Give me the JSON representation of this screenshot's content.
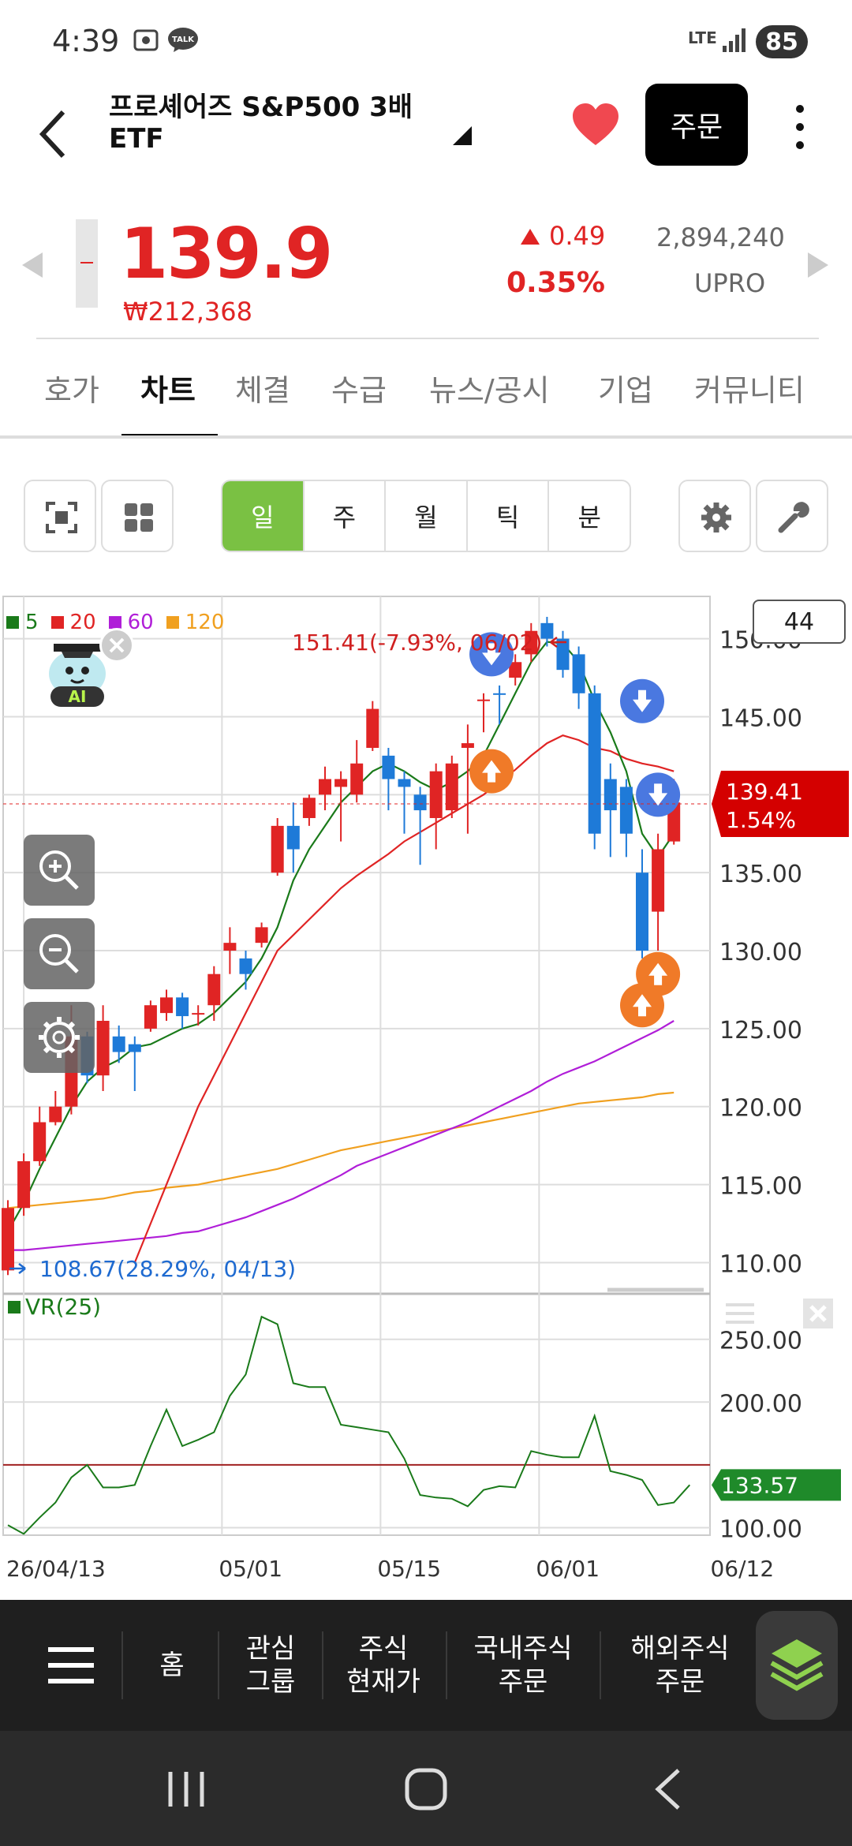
{
  "status_bar": {
    "time": "4:39",
    "talk_badge": "TALK",
    "network": "LTE",
    "battery": "85"
  },
  "header": {
    "title": "프로셰어즈 S&P500 3배 ETF",
    "order_button": "주문"
  },
  "quote": {
    "price": "139.9",
    "krw_price": "₩212,368",
    "change": "0.49",
    "change_pct": "0.35%",
    "volume": "2,894,240",
    "ticker": "UPRO"
  },
  "tabs": [
    "호가",
    "차트",
    "체결",
    "수급",
    "뉴스/공시",
    "기업",
    "커뮤니티"
  ],
  "active_tab": "차트",
  "period_buttons": [
    "일",
    "주",
    "월",
    "틱",
    "분"
  ],
  "active_period": "일",
  "chart_data": {
    "type": "candlestick",
    "legend": [
      {
        "name": "5",
        "color": "#1a7a1a"
      },
      {
        "name": "20",
        "color": "#e02424"
      },
      {
        "name": "60",
        "color": "#b01ed8"
      },
      {
        "name": "120",
        "color": "#f0a020"
      }
    ],
    "count_box": "44",
    "y_ticks": [
      "150.00",
      "145.00",
      "140.00",
      "135.00",
      "130.00",
      "125.00",
      "120.00",
      "115.00",
      "110.00"
    ],
    "y_tick_values": [
      150,
      145,
      140,
      135,
      130,
      125,
      120,
      115,
      110
    ],
    "ylim": [
      108.0,
      151.7
    ],
    "x_labels": [
      "26/04/13",
      "05/01",
      "05/15",
      "06/01",
      "06/12"
    ],
    "x_label_index": [
      1,
      13.5,
      23.5,
      33.5,
      44.5
    ],
    "high_annotation": "151.41(-7.93%, 06/02)",
    "low_annotation": "108.67(28.29%, 04/13)",
    "current_price_label": "139.41",
    "current_pct_label": "1.54%",
    "current_price": 139.41,
    "candles": [
      [
        109.5,
        113.5,
        109.2,
        114.0
      ],
      [
        113.5,
        116.5,
        113.0,
        117.0
      ],
      [
        116.5,
        119.0,
        116.2,
        120.0
      ],
      [
        119.0,
        120.0,
        118.8,
        121.0
      ],
      [
        120.0,
        124.5,
        119.5,
        126.5
      ],
      [
        124.5,
        122.0,
        121.5,
        124.8
      ],
      [
        122.0,
        125.5,
        121.0,
        126.5
      ],
      [
        124.5,
        123.5,
        122.8,
        125.2
      ],
      [
        124.0,
        123.5,
        121.0,
        124.5
      ],
      [
        125.0,
        126.5,
        124.8,
        126.8
      ],
      [
        126.0,
        127.0,
        125.5,
        127.5
      ],
      [
        127.0,
        125.8,
        125.0,
        127.3
      ],
      [
        126.0,
        126.0,
        125.2,
        126.5
      ],
      [
        126.5,
        128.5,
        125.5,
        129.0
      ],
      [
        130.0,
        130.5,
        128.5,
        131.5
      ],
      [
        129.5,
        128.5,
        127.5,
        130.0
      ],
      [
        130.5,
        131.5,
        130.2,
        131.8
      ],
      [
        135.0,
        138.0,
        134.8,
        138.5
      ],
      [
        138.0,
        136.5,
        135.0,
        139.5
      ],
      [
        138.5,
        139.8,
        138.0,
        140.0
      ],
      [
        140.0,
        141.0,
        139.0,
        141.8
      ],
      [
        140.5,
        141.0,
        137.0,
        141.5
      ],
      [
        140.0,
        142.0,
        139.5,
        143.5
      ],
      [
        143.0,
        145.5,
        142.8,
        146.0
      ],
      [
        142.5,
        141.0,
        139.0,
        143.0
      ],
      [
        141.0,
        140.5,
        137.5,
        141.5
      ],
      [
        140.0,
        139.0,
        135.5,
        140.5
      ],
      [
        138.5,
        141.5,
        136.5,
        142.0
      ],
      [
        139.0,
        142.0,
        138.5,
        142.5
      ],
      [
        143.0,
        143.3,
        137.5,
        144.5
      ],
      [
        146.0,
        146.1,
        144.0,
        146.5
      ],
      [
        146.5,
        146.4,
        144.5,
        147.0
      ],
      [
        147.5,
        148.5,
        147.0,
        149.0
      ],
      [
        149.0,
        150.5,
        148.5,
        151.0
      ],
      [
        151.0,
        150.0,
        149.5,
        151.4
      ],
      [
        150.0,
        148.0,
        147.5,
        150.5
      ],
      [
        149.0,
        146.5,
        145.5,
        149.5
      ],
      [
        146.5,
        137.5,
        136.5,
        147.0
      ],
      [
        141.0,
        139.0,
        136.0,
        142.0
      ],
      [
        140.5,
        137.5,
        136.0,
        141.0
      ],
      [
        135.0,
        130.0,
        129.5,
        136.5
      ],
      [
        132.5,
        136.5,
        130.0,
        137.5
      ],
      [
        137.0,
        139.5,
        136.8,
        141.0
      ]
    ],
    "ma5": [
      112.0,
      113.8,
      116.0,
      118.0,
      120.0,
      121.6,
      122.5,
      123.0,
      123.8,
      124.0,
      124.5,
      125.0,
      125.3,
      126.0,
      127.0,
      128.0,
      129.5,
      131.5,
      134.5,
      136.5,
      138.0,
      139.5,
      140.5,
      141.5,
      142.0,
      141.5,
      140.8,
      140.3,
      140.8,
      141.5,
      142.5,
      144.5,
      146.5,
      148.5,
      149.8,
      149.7,
      148.5,
      146.0,
      144.0,
      141.5,
      137.5,
      136.0,
      137.5
    ],
    "ma20": [
      null,
      null,
      null,
      null,
      null,
      null,
      null,
      null,
      110.0,
      112.5,
      115.0,
      117.5,
      120.0,
      122.0,
      124.0,
      126.0,
      128.0,
      130.0,
      131.0,
      132.0,
      133.0,
      134.0,
      134.8,
      135.5,
      136.2,
      137.0,
      137.6,
      138.2,
      138.8,
      139.4,
      140.0,
      140.8,
      141.6,
      142.5,
      143.3,
      143.8,
      143.5,
      143.0,
      142.8,
      142.3,
      142.0,
      141.8,
      141.5
    ],
    "ma60": [
      110.8,
      110.8,
      110.9,
      111.0,
      111.1,
      111.2,
      111.3,
      111.4,
      111.5,
      111.6,
      111.7,
      111.9,
      112.0,
      112.3,
      112.6,
      112.9,
      113.3,
      113.7,
      114.1,
      114.6,
      115.1,
      115.6,
      116.2,
      116.6,
      117.0,
      117.4,
      117.8,
      118.2,
      118.6,
      119.0,
      119.5,
      120.0,
      120.5,
      121.0,
      121.6,
      122.1,
      122.5,
      122.9,
      123.4,
      123.9,
      124.4,
      124.9,
      125.5
    ],
    "ma120": [
      113.5,
      113.6,
      113.7,
      113.8,
      113.9,
      114.0,
      114.1,
      114.3,
      114.5,
      114.6,
      114.8,
      114.9,
      115.0,
      115.2,
      115.4,
      115.6,
      115.8,
      116.0,
      116.3,
      116.6,
      116.9,
      117.2,
      117.4,
      117.6,
      117.8,
      118.0,
      118.2,
      118.4,
      118.6,
      118.8,
      119.0,
      119.2,
      119.4,
      119.6,
      119.8,
      120.0,
      120.2,
      120.3,
      120.4,
      120.5,
      120.6,
      120.8,
      120.9
    ],
    "signals": [
      {
        "index": 30.5,
        "type": "sell",
        "price": 149.0
      },
      {
        "index": 30.5,
        "type": "buy",
        "price": 141.5
      },
      {
        "index": 40.0,
        "type": "sell",
        "price": 146.0
      },
      {
        "index": 41.0,
        "type": "sell",
        "price": 140.0
      },
      {
        "index": 41.0,
        "type": "buy",
        "price": 128.5
      },
      {
        "index": 40.0,
        "type": "buy",
        "price": 126.5
      }
    ],
    "vr": {
      "label": "VR(25)",
      "y_ticks": [
        "250.00",
        "200.00",
        "100.00"
      ],
      "y_tick_values": [
        250,
        200,
        100
      ],
      "ylim": [
        94,
        280
      ],
      "reference_line": 150,
      "current_label": "133.57",
      "values": [
        102,
        95,
        108,
        120,
        140,
        150,
        132,
        132,
        134,
        165,
        194,
        165,
        170,
        176,
        205,
        222,
        268,
        262,
        215,
        212,
        212,
        182,
        180,
        178,
        176,
        155,
        126,
        124,
        123,
        117,
        130,
        133,
        132,
        161,
        158,
        156,
        156,
        189,
        145,
        142,
        138,
        118,
        120,
        134
      ]
    }
  },
  "bottom_nav": {
    "home": "홈",
    "watch_group": "관심\n그룹",
    "stock_price": "주식\n현재가",
    "domestic_order": "국내주식\n주문",
    "overseas_order": "해외주식\n주문"
  },
  "colors": {
    "up": "#e02424",
    "down": "#1e7ad8",
    "accent": "#7ac143",
    "ma5": "#1a7a1a",
    "ma20": "#e02424",
    "ma60": "#b01ed8",
    "ma120": "#f0a020"
  }
}
